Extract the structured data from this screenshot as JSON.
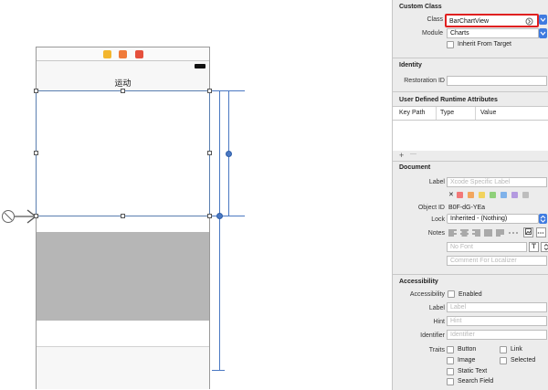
{
  "canvas": {
    "nav_title": "运动"
  },
  "inspector": {
    "custom_class": {
      "title": "Custom Class",
      "class_label": "Class",
      "class_value": "BarChartView",
      "module_label": "Module",
      "module_value": "Charts",
      "inherit_label": "Inherit From Target"
    },
    "identity": {
      "title": "Identity",
      "restoration_label": "Restoration ID"
    },
    "runtime": {
      "title": "User Defined Runtime Attributes",
      "columns": [
        "Key Path",
        "Type",
        "Value"
      ],
      "add_symbol": "+",
      "remove_symbol": "—"
    },
    "document": {
      "title": "Document",
      "label_label": "Label",
      "label_placeholder": "Xcode Specific Label",
      "clear_symbol": "✕",
      "label_colors": [
        "#f27878",
        "#f2a65e",
        "#f2d35e",
        "#8fd07a",
        "#7fb2ea",
        "#b49ae0",
        "#bdbdbd"
      ],
      "object_id_label": "Object ID",
      "object_id_value": "B0F-dG-YEa",
      "lock_label": "Lock",
      "lock_value": "Inherited - (Nothing)",
      "notes_label": "Notes",
      "font_placeholder": "No Font",
      "comment_placeholder": "Comment For Localizer"
    },
    "accessibility": {
      "title": "Accessibility",
      "accessibility_label": "Accessibility",
      "enabled_label": "Enabled",
      "label_label": "Label",
      "label_placeholder": "Label",
      "hint_label": "Hint",
      "hint_placeholder": "Hint",
      "identifier_label": "Identifier",
      "identifier_placeholder": "Identifier",
      "traits_label": "Traits",
      "traits": [
        "Button",
        "Link",
        "Image",
        "Selected",
        "Static Text",
        "Search Field"
      ]
    }
  },
  "colors": {
    "accent_blue": "#3f7be0",
    "highlight_red": "#e02020",
    "guide_blue": "#4a78c2",
    "placeholder_gray": "#b6b6b6"
  }
}
